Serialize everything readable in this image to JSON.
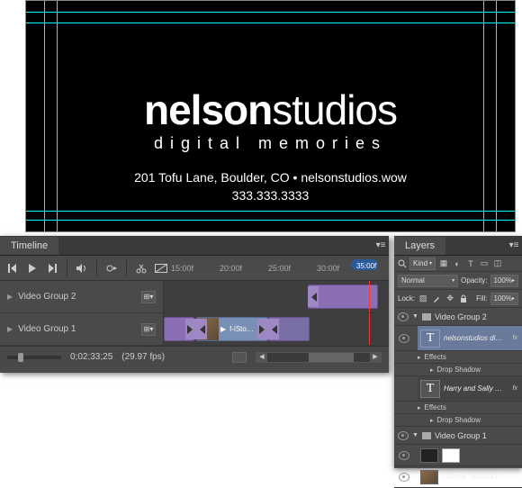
{
  "canvas": {
    "logo_bold": "nelson",
    "logo_thin": "studios",
    "logo_sub": "digital memories",
    "address": "201 Tofu Lane, Boulder, CO • nelsonstudios.wow",
    "phone": "333.333.3333"
  },
  "timeline": {
    "tab_label": "Timeline",
    "ruler": {
      "t1": "15:00f",
      "t2": "20:00f",
      "t3": "25:00f",
      "t4": "30:00f",
      "playhead": "35:00f"
    },
    "tracks": {
      "g2": "Video Group 2",
      "g1": "Video Group 1"
    },
    "clip_label": "f-iSto…",
    "timecode": "0;02;33;25",
    "fps": "(29.97 fps)"
  },
  "layers": {
    "tab_label": "Layers",
    "filter_kind": "Kind",
    "blend_mode": "Normal",
    "opacity_label": "Opacity:",
    "opacity_value": "100%",
    "lock_label": "Lock:",
    "fill_label": "Fill:",
    "fill_value": "100%",
    "groups": {
      "g2": "Video Group 2",
      "g1": "Video Group 1"
    },
    "text_layer_1": "nelsonstudios di…",
    "text_layer_2": "Harry and Sally …",
    "effects_label": "Effects",
    "drop_shadow_label": "Drop Shadow",
    "img_layer": "f-iStock_0000147…",
    "type_glyph": "T"
  }
}
